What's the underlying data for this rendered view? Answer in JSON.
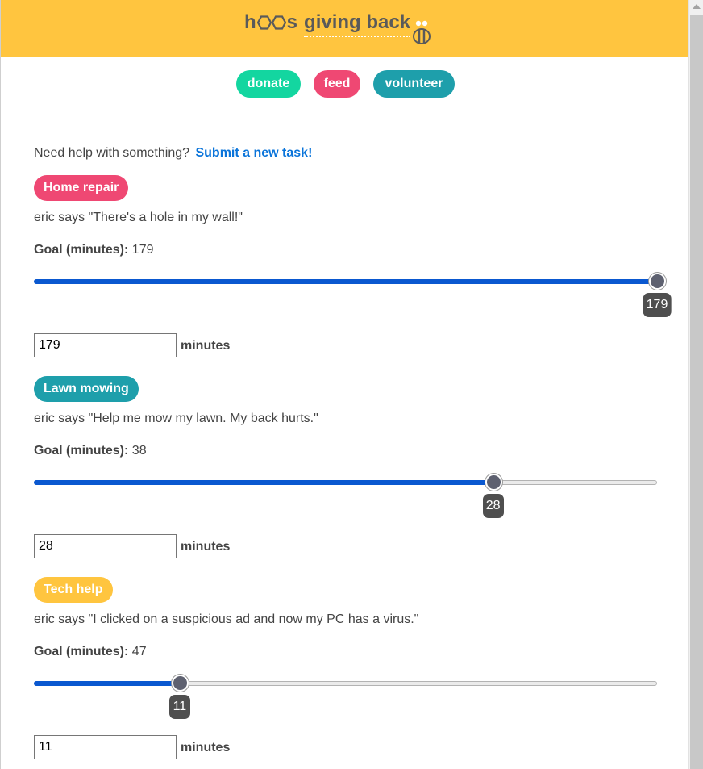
{
  "header": {
    "logo_h": "h",
    "logo_s": "s",
    "logo_giving": "giving back",
    "brand_color": "#ffc53f"
  },
  "nav": [
    {
      "label": "donate",
      "color": "#13d6a0"
    },
    {
      "label": "feed",
      "color": "#ef4873"
    },
    {
      "label": "volunteer",
      "color": "#1e9fab"
    }
  ],
  "intro": {
    "text": "Need help with something?",
    "link": "Submit a new task!"
  },
  "tasks": [
    {
      "category": "Home repair",
      "color": "#ef4873",
      "description": "eric says \"There's a hole in my wall!\"",
      "goal_label": "Goal (minutes):",
      "goal": "179",
      "slider_value": "179",
      "slider_fraction": 1.0,
      "input_value": "179",
      "unit": "minutes"
    },
    {
      "category": "Lawn mowing",
      "color": "#1e9fab",
      "description": "eric says \"Help me mow my lawn. My back hurts.\"",
      "goal_label": "Goal (minutes):",
      "goal": "38",
      "slider_value": "28",
      "slider_fraction": 0.737,
      "input_value": "28",
      "unit": "minutes"
    },
    {
      "category": "Tech help",
      "color": "#ffc53f",
      "description": "eric says \"I clicked on a suspicious ad and now my PC has a virus.\"",
      "goal_label": "Goal (minutes):",
      "goal": "47",
      "slider_value": "11",
      "slider_fraction": 0.234,
      "input_value": "11",
      "unit": "minutes"
    }
  ]
}
